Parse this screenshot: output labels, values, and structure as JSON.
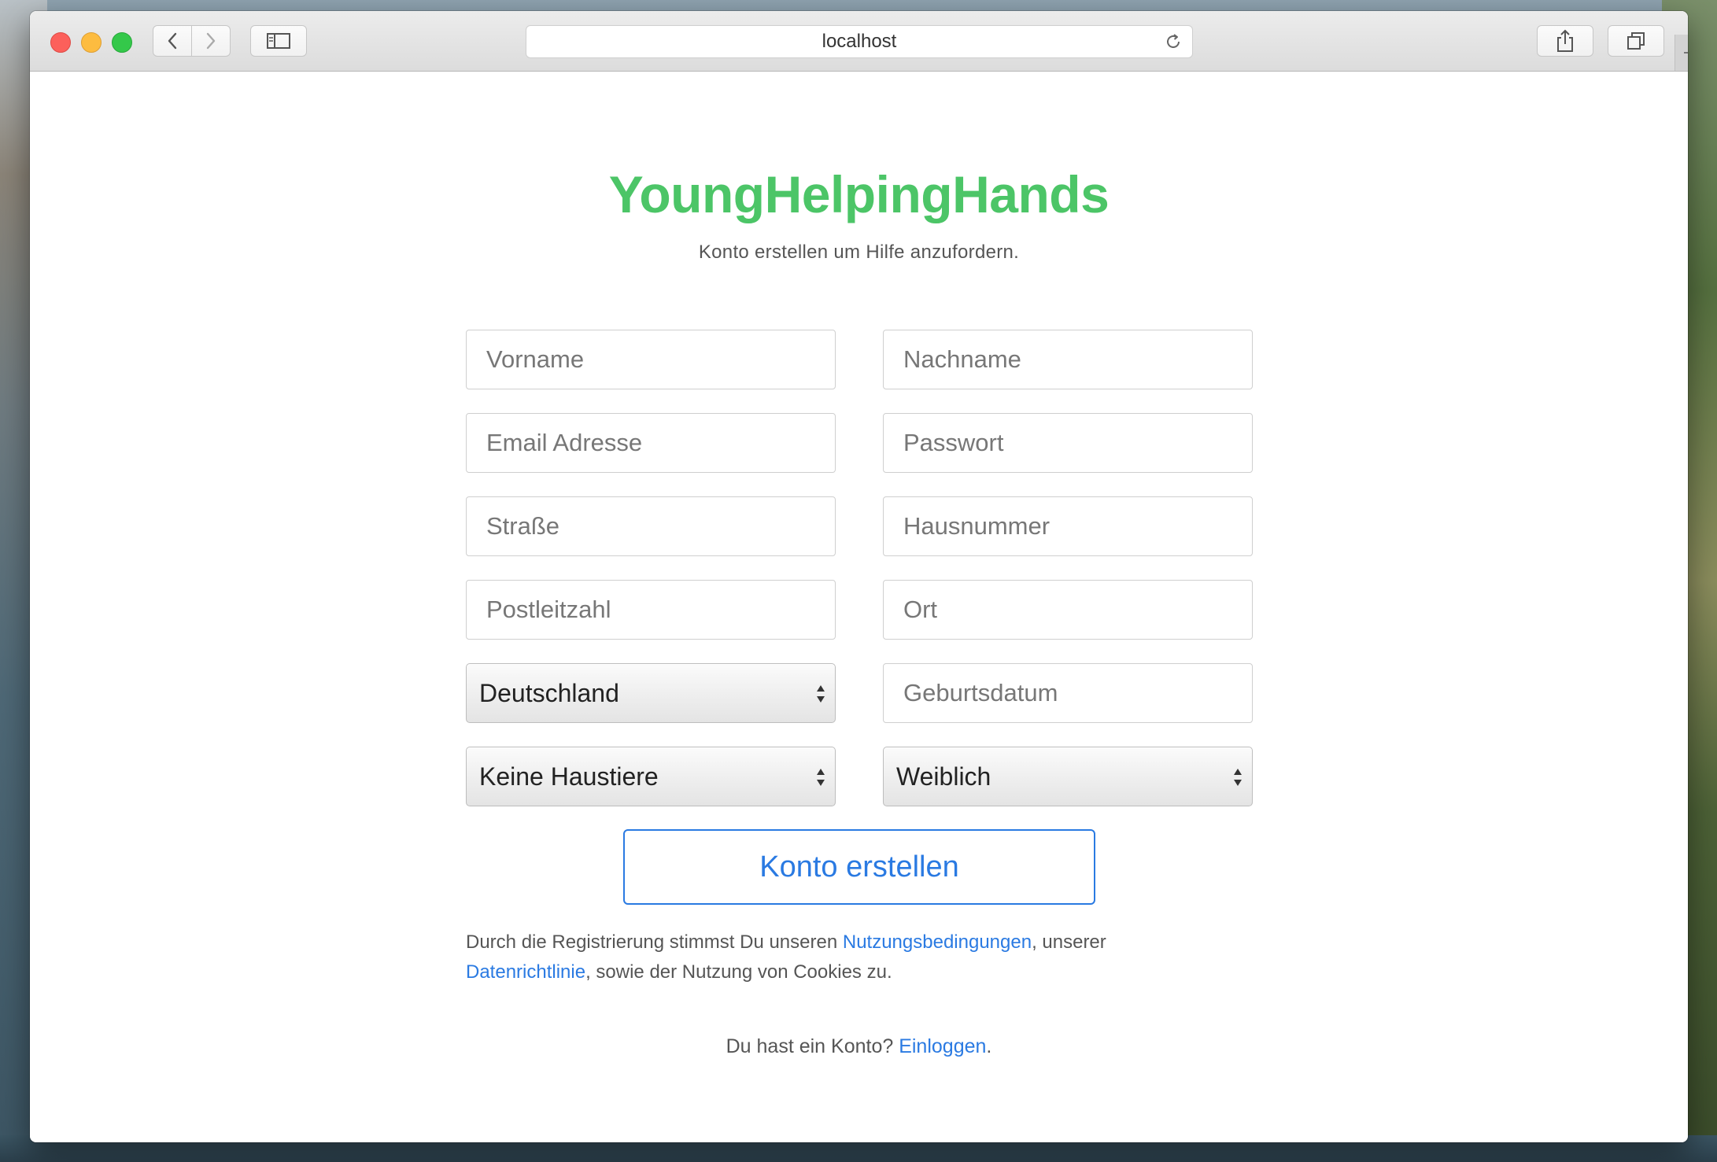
{
  "browser": {
    "url": "localhost",
    "icons": {
      "back": "chevron-left-icon",
      "forward": "chevron-right-icon",
      "sidebar": "sidebar-icon",
      "reload": "reload-icon",
      "share": "share-icon",
      "tabs": "tabs-overview-icon",
      "new_tab": "plus-icon"
    }
  },
  "page": {
    "brand": "YoungHelpingHands",
    "subtitle": "Konto erstellen um Hilfe anzufordern.",
    "brand_color": "#4cc567",
    "link_color": "#2a7ae2"
  },
  "form": {
    "first_name_placeholder": "Vorname",
    "last_name_placeholder": "Nachname",
    "email_placeholder": "Email Adresse",
    "password_placeholder": "Passwort",
    "street_placeholder": "Straße",
    "house_number_placeholder": "Hausnummer",
    "postal_code_placeholder": "Postleitzahl",
    "city_placeholder": "Ort",
    "country_value": "Deutschland",
    "birthdate_placeholder": "Geburtsdatum",
    "pets_value": "Keine Haustiere",
    "gender_value": "Weiblich",
    "submit_label": "Konto erstellen"
  },
  "terms": {
    "prefix": "Durch die Registrierung stimmst Du unseren ",
    "terms_link": "Nutzungsbedingungen",
    "middle": ", unserer ",
    "privacy_link": "Datenrichtlinie",
    "suffix": ", sowie der Nutzung von Cookies zu."
  },
  "login": {
    "prompt": "Du hast ein Konto? ",
    "link": "Einloggen",
    "suffix": "."
  }
}
